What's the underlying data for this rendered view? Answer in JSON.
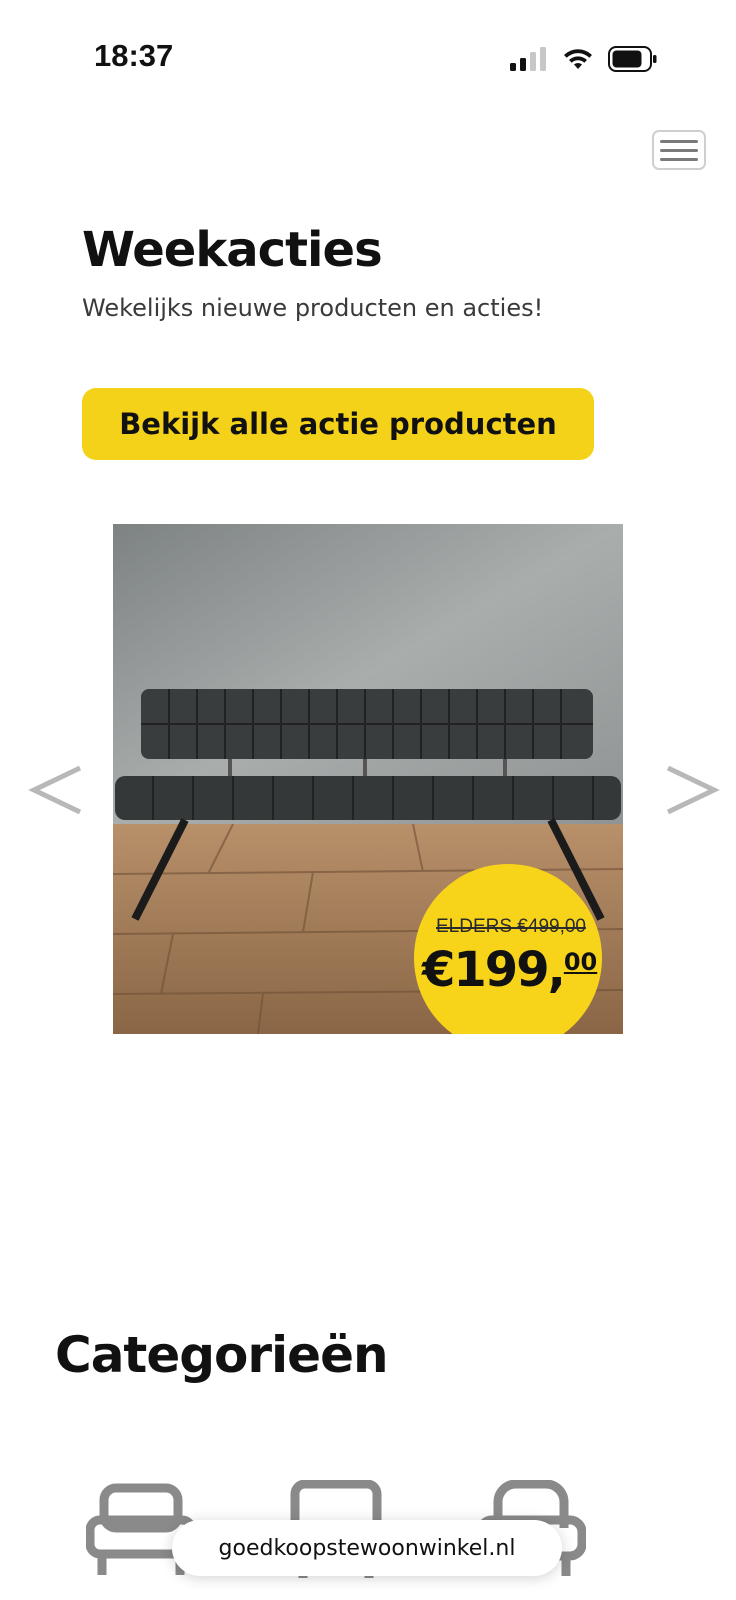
{
  "status_bar": {
    "time": "18:37"
  },
  "header": {
    "menu_icon": "hamburger-menu-icon"
  },
  "hero": {
    "title": "Weekacties",
    "subtitle": "Wekelijks nieuwe producten en acties!",
    "cta_label": "Bekijk alle actie producten"
  },
  "carousel": {
    "prev_label": "<",
    "next_label": ">",
    "badge": {
      "old_price": "ELDERS €499,00",
      "new_price_main": "€199,",
      "new_price_cents": "00"
    }
  },
  "categories": {
    "title": "Categorieën",
    "icons": [
      "sofa-icon",
      "chair-icon",
      "armchair-icon"
    ]
  },
  "browser": {
    "url": "goedkoopstewoonwinkel.nl"
  },
  "colors": {
    "accent_yellow": "#f5d21a",
    "arrow_gray": "#b8b8b8"
  }
}
